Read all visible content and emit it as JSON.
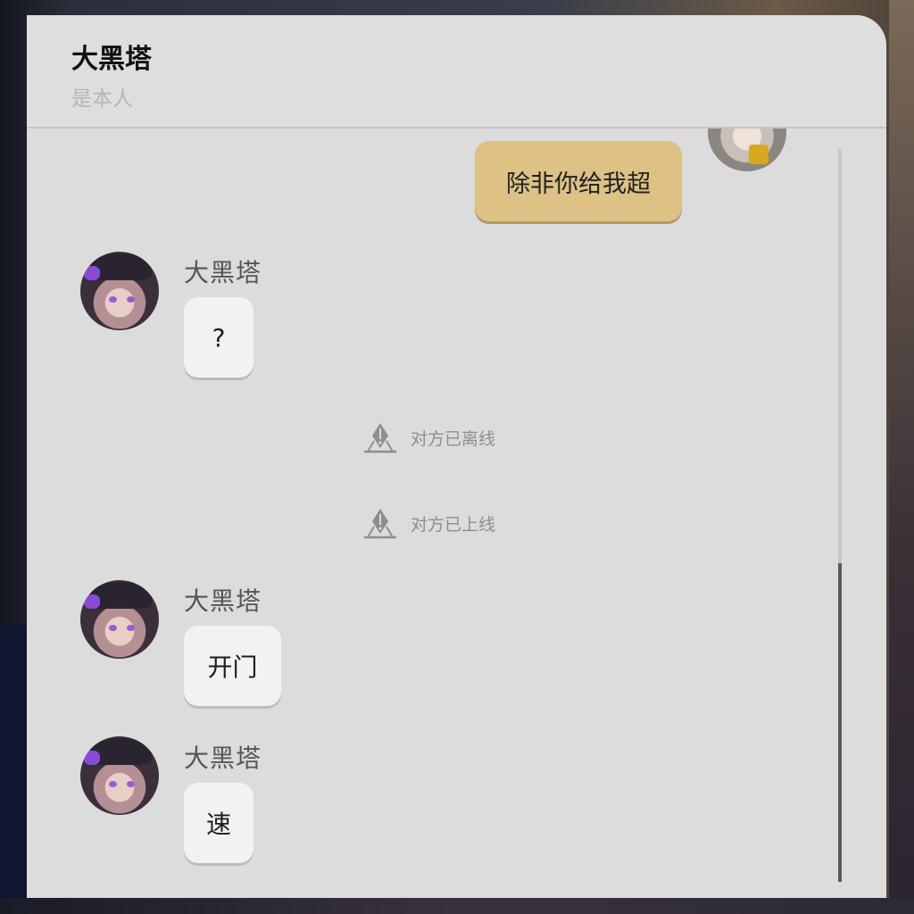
{
  "header": {
    "title": "大黑塔",
    "subtitle": "是本人"
  },
  "messages": [
    {
      "sender": "self",
      "text": "除非你给我超"
    },
    {
      "sender": "大黑塔",
      "text": "?"
    },
    {
      "type": "system",
      "icon": "notice-icon",
      "text": "对方已离线"
    },
    {
      "type": "system",
      "icon": "notice-icon",
      "text": "对方已上线"
    },
    {
      "sender": "大黑塔",
      "text": "开门"
    },
    {
      "sender": "大黑塔",
      "text": "速"
    }
  ],
  "colors": {
    "panel": "#dcdcdc",
    "self_bubble": "#ddc185",
    "other_bubble": "#f2f2f2",
    "scroll_thumb": "#5a5a5a"
  }
}
